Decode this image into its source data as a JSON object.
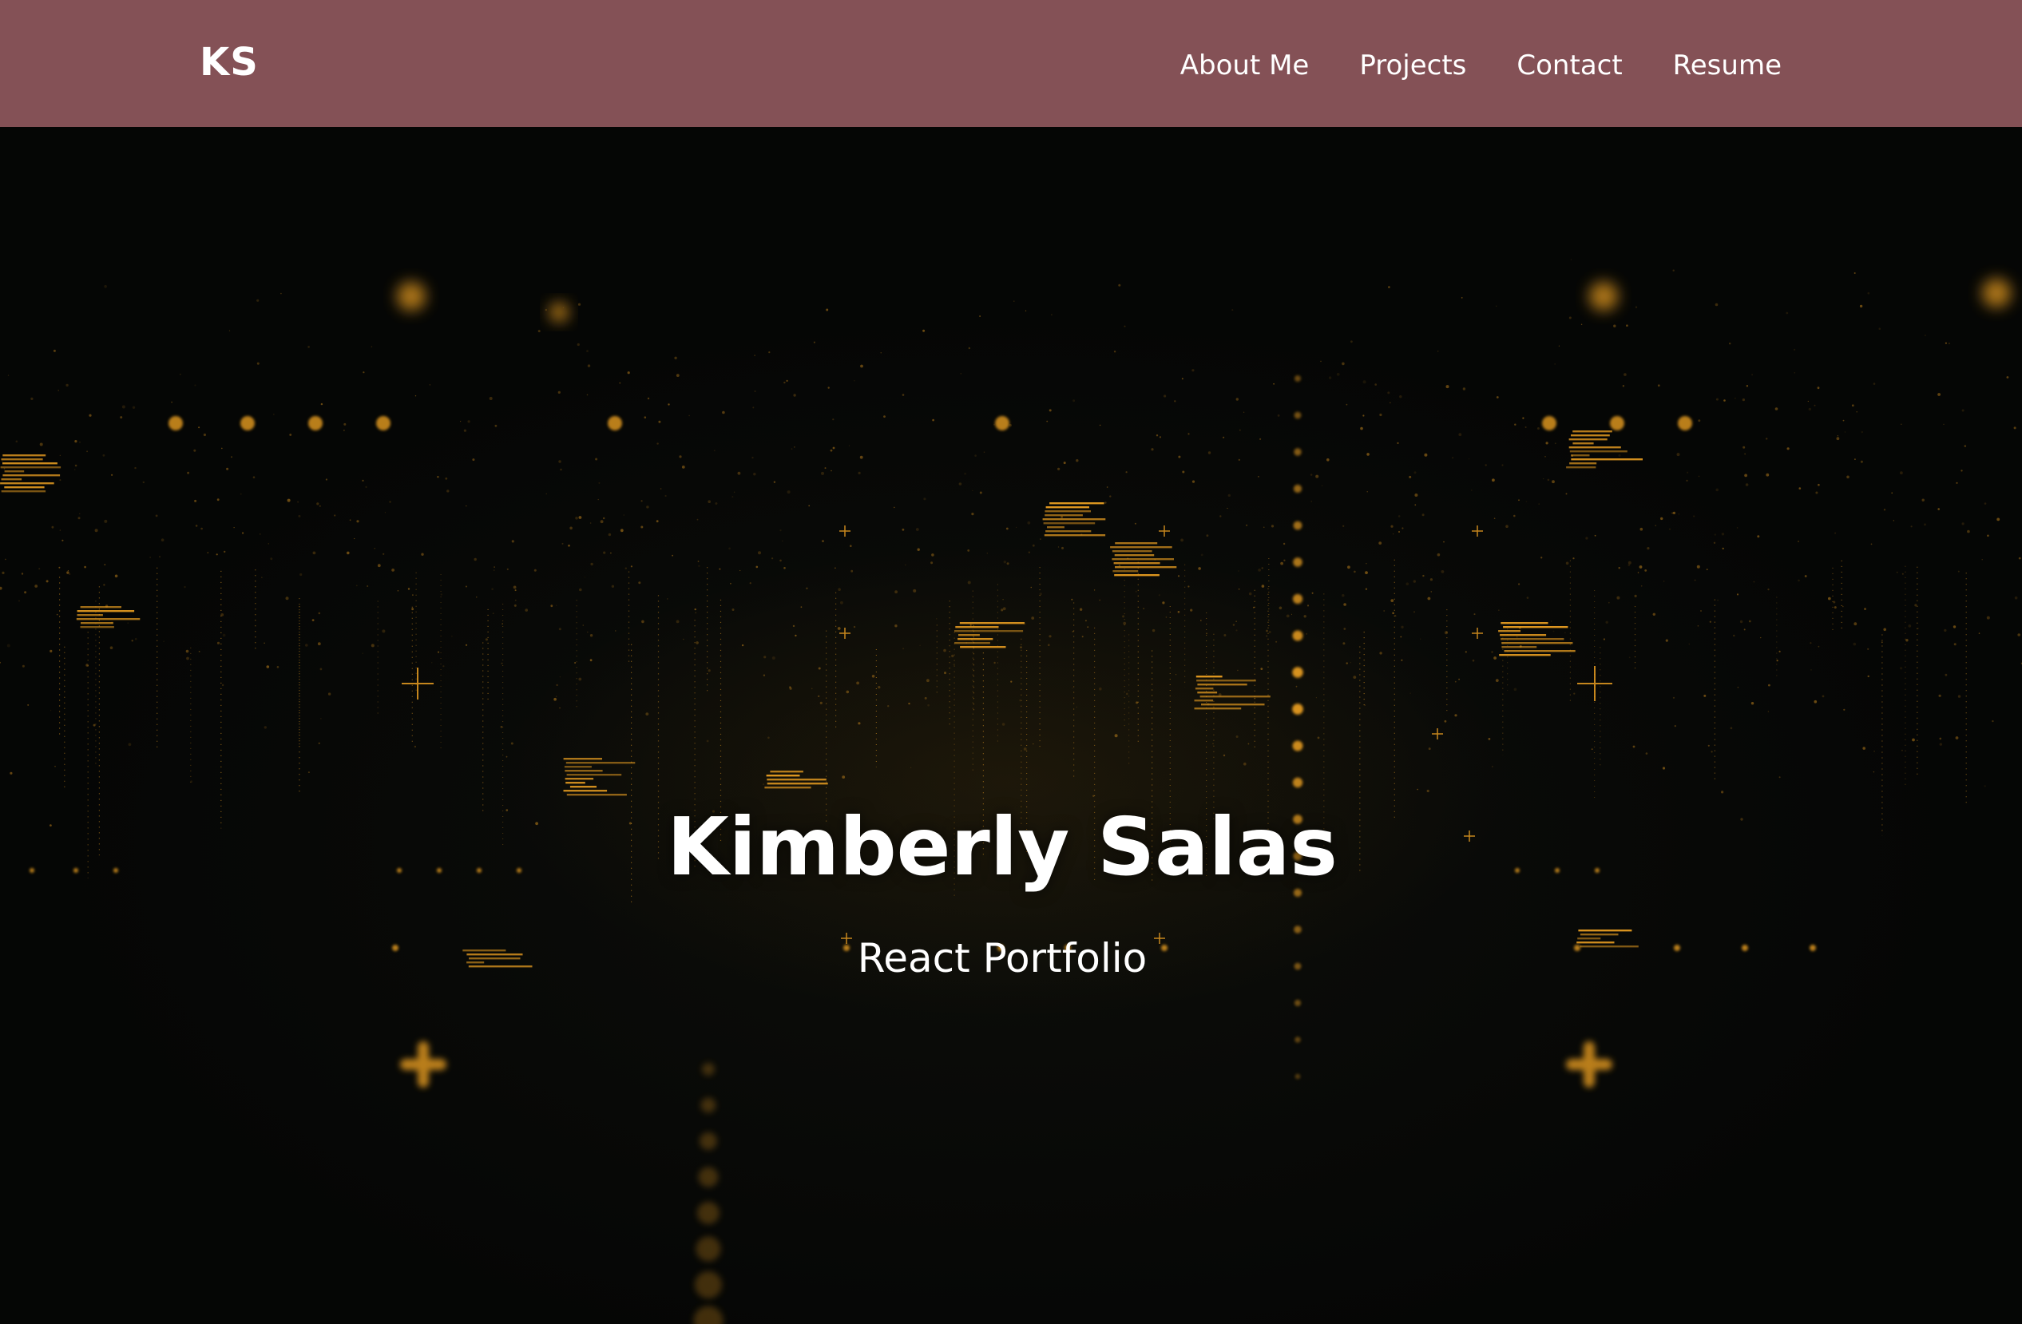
{
  "navbar": {
    "logo": "KS",
    "links": [
      "About Me",
      "Projects",
      "Contact",
      "Resume"
    ]
  },
  "hero": {
    "title": "Kimberly Salas",
    "subtitle": "React Portfolio"
  },
  "colors": {
    "navbar_bg": "#845156",
    "hero_bg": "#050605",
    "accent_glow": "#f5a623",
    "text": "#ffffff"
  }
}
